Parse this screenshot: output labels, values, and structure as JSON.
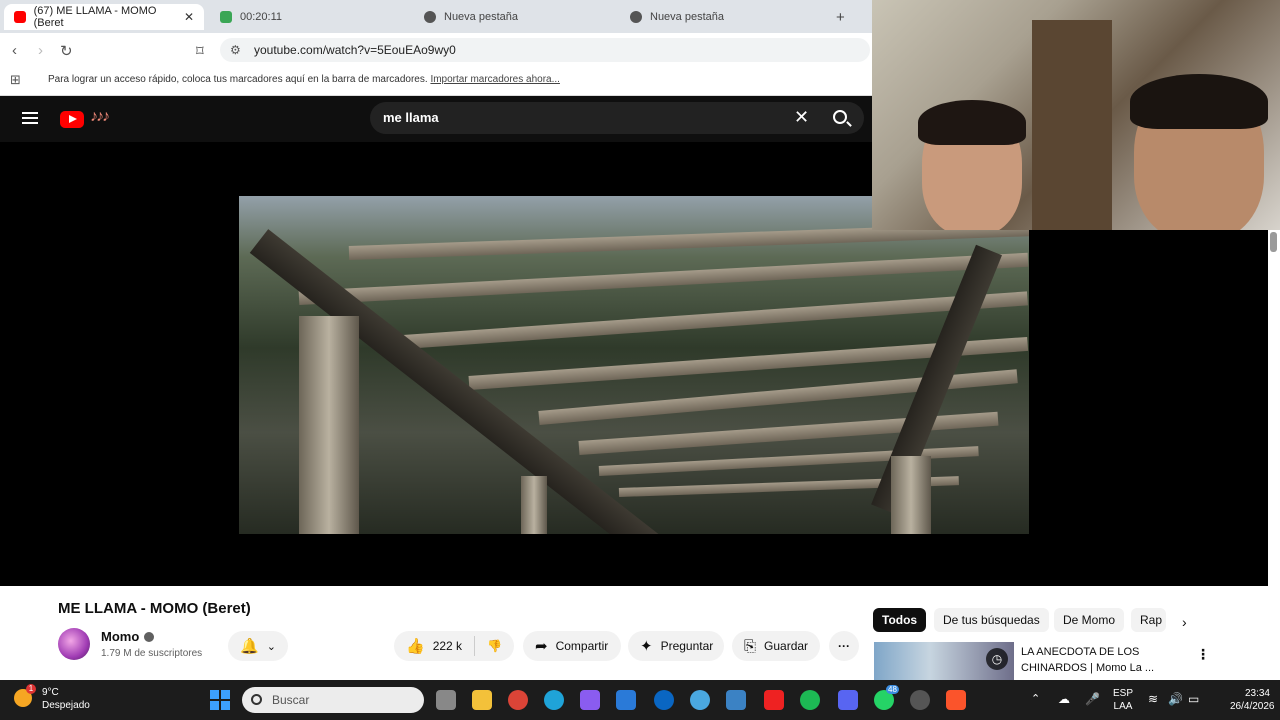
{
  "browser": {
    "tabs": [
      {
        "label": "(67) ME LLAMA - MOMO (Beret",
        "active": true
      },
      {
        "label": "00:20:11",
        "active": false
      },
      {
        "label": "Nueva pestaña",
        "active": false
      },
      {
        "label": "Nueva pestaña",
        "active": false
      }
    ],
    "new_tab_label": "+",
    "url": "youtube.com/watch?v=5EouEAo9wy0",
    "bookmarks_text": "Para lograr un acceso rápido, coloca tus marcadores aquí en la barra de marcadores.",
    "bookmarks_link": "Importar marcadores ahora..."
  },
  "youtube": {
    "search_query": "me llama",
    "video": {
      "title": "ME LLAMA - MOMO (Beret)",
      "channel": "Momo",
      "subscribers": "1.79 M de suscriptores",
      "likes": "222 k",
      "share_label": "Compartir",
      "ask_label": "Preguntar",
      "save_label": "Guardar"
    },
    "chips": [
      "Todos",
      "De tus búsquedas",
      "De Momo",
      "Rap"
    ],
    "recommendation": {
      "title": "LA ANECDOTA DE LOS CHINARDOS | Momo La ..."
    }
  },
  "taskbar": {
    "weather_temp": "9°C",
    "weather_desc": "Despejado",
    "weather_badge": "1",
    "search_placeholder": "Buscar",
    "lang_1": "ESP",
    "lang_2": "LAA",
    "time": "23:34",
    "date": "26/4/2026",
    "whatsapp_badge": "48"
  },
  "colors": {
    "yt_red": "#ff0000",
    "accent_blue": "#3ca0ff"
  }
}
